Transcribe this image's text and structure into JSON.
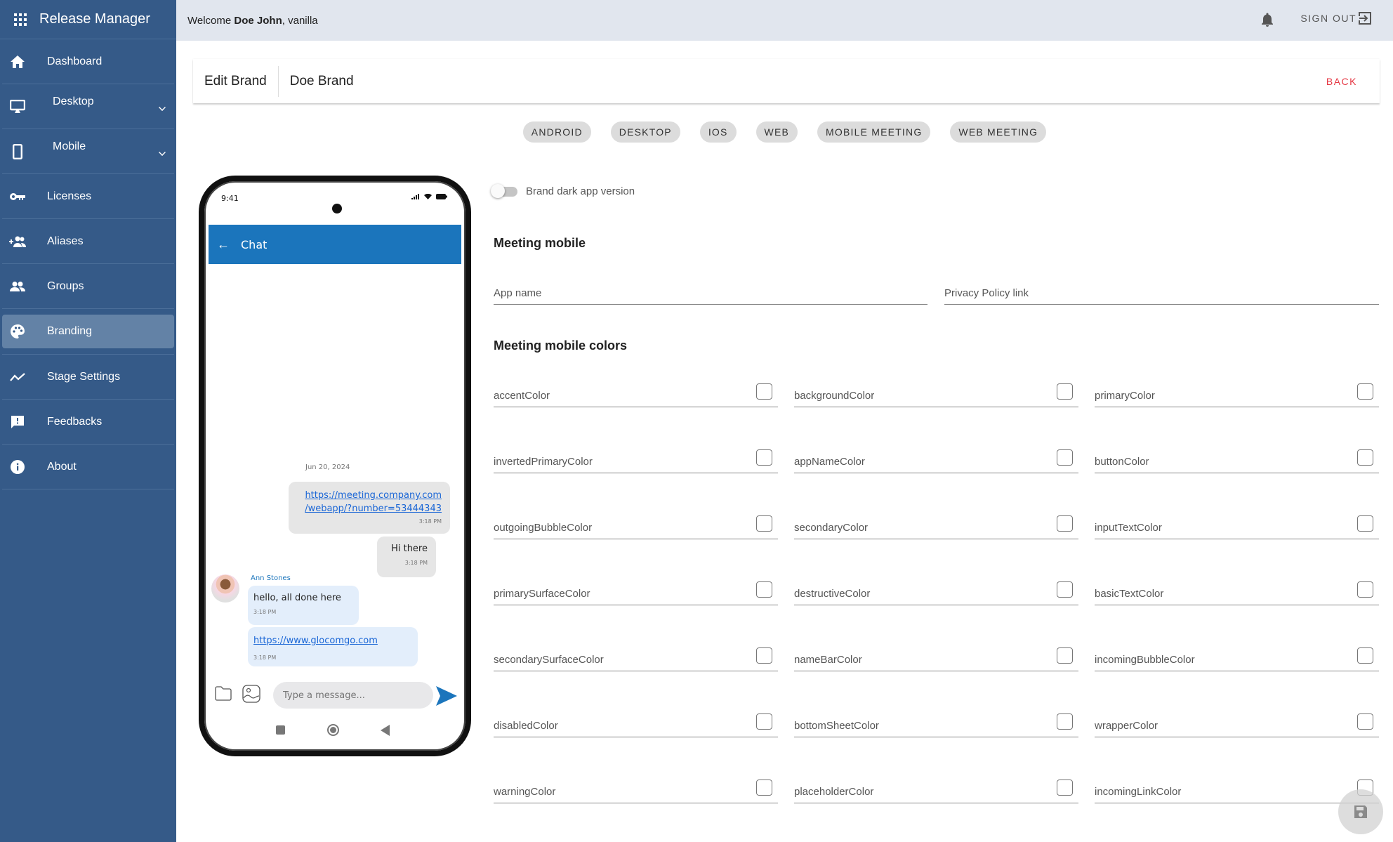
{
  "app": {
    "title": "Release Manager"
  },
  "topbar": {
    "welcome_prefix": "Welcome ",
    "user_name": "Doe John",
    "welcome_suffix": ", vanilla",
    "signout_label": "SIGN OUT"
  },
  "sidebar": {
    "items": [
      {
        "label": "Dashboard",
        "icon": "home-icon"
      },
      {
        "label": "Desktop",
        "icon": "desktop-icon",
        "expandable": true
      },
      {
        "label": "Mobile",
        "icon": "mobile-icon",
        "expandable": true
      },
      {
        "label": "Licenses",
        "icon": "key-icon"
      },
      {
        "label": "Aliases",
        "icon": "group-add-icon"
      },
      {
        "label": "Groups",
        "icon": "people-icon"
      },
      {
        "label": "Branding",
        "icon": "palette-icon",
        "active": true
      },
      {
        "label": "Stage Settings",
        "icon": "trend-icon"
      },
      {
        "label": "Feedbacks",
        "icon": "feedback-icon"
      },
      {
        "label": "About",
        "icon": "info-icon"
      }
    ]
  },
  "header": {
    "label": "Edit Brand",
    "value": "Doe Brand",
    "back_label": "BACK"
  },
  "platform_tabs": [
    "ANDROID",
    "DESKTOP",
    "IOS",
    "WEB",
    "MOBILE MEETING",
    "WEB MEETING"
  ],
  "preview": {
    "time": "9:41",
    "chat_title": "Chat",
    "date": "Jun 20, 2024",
    "messages": [
      {
        "dir": "out",
        "link": "https://meeting.company.com/webapp/?number=53444343",
        "link_line1": "https://meeting.company.com",
        "link_line2": "/webapp/?number=53444343",
        "time": "3:18 PM"
      },
      {
        "dir": "out",
        "text": "Hi there",
        "time": "3:18 PM"
      },
      {
        "dir": "in",
        "sender": "Ann Stones",
        "text": "hello, all done here",
        "time": "3:18 PM"
      },
      {
        "dir": "in",
        "link": "https://www.glocomgo.com",
        "time": "3:18 PM"
      }
    ],
    "input_placeholder": "Type a message...",
    "colors": {
      "appbar": "#1b75bc",
      "outgoing": "#e6e6e6",
      "incoming": "#e3eefb"
    }
  },
  "form": {
    "dark_toggle_label": "Brand dark app version",
    "dark_toggle_on": false,
    "section1_title": "Meeting mobile",
    "app_name_label": "App name",
    "privacy_label": "Privacy Policy link",
    "section2_title": "Meeting mobile colors",
    "colors": [
      "accentColor",
      "backgroundColor",
      "primaryColor",
      "invertedPrimaryColor",
      "appNameColor",
      "buttonColor",
      "outgoingBubbleColor",
      "secondaryColor",
      "inputTextColor",
      "primarySurfaceColor",
      "destructiveColor",
      "basicTextColor",
      "secondarySurfaceColor",
      "nameBarColor",
      "incomingBubbleColor",
      "disabledColor",
      "bottomSheetColor",
      "wrapperColor",
      "warningColor",
      "placeholderColor",
      "incomingLinkColor"
    ]
  },
  "theme": {
    "sidebar_bg": "#355a88",
    "accent_red": "#e53945"
  }
}
